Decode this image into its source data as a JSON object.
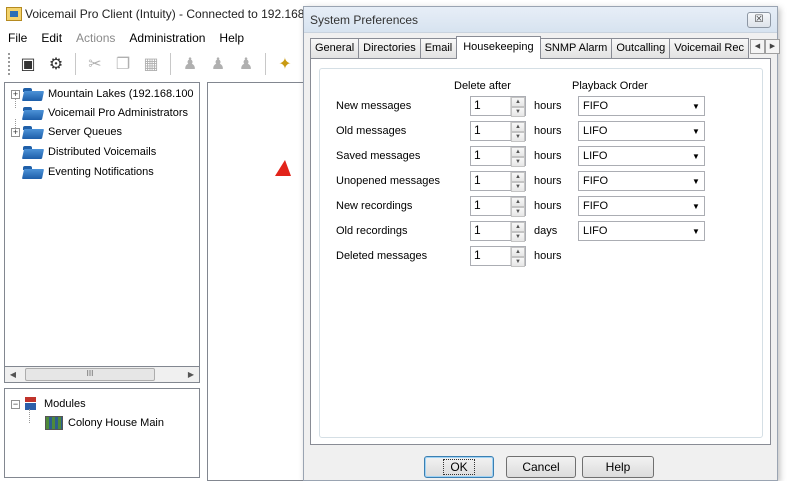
{
  "main_window": {
    "title": "Voicemail Pro Client (Intuity) - Connected to 192.168.",
    "menu": [
      "File",
      "Edit",
      "Actions",
      "Administration",
      "Help"
    ],
    "tree": [
      {
        "label": "Mountain Lakes (192.168.100",
        "expander": "+"
      },
      {
        "label": "Voicemail Pro Administrators",
        "expander": ""
      },
      {
        "label": "Server Queues",
        "expander": "+"
      },
      {
        "label": "Distributed Voicemails",
        "expander": ""
      },
      {
        "label": "Eventing Notifications",
        "expander": ""
      }
    ],
    "scroll_thumb_label": "III",
    "modules": {
      "label": "Modules",
      "expander": "−",
      "child": "Colony House Main"
    }
  },
  "dialog": {
    "title": "System Preferences",
    "close_glyph": "☒",
    "tabs": [
      "General",
      "Directories",
      "Email",
      "Housekeeping",
      "SNMP Alarm",
      "Outcalling",
      "Voicemail Rec"
    ],
    "active_tab": "Housekeeping",
    "columns": {
      "delete_after": "Delete after",
      "playback_order": "Playback Order"
    },
    "rows": [
      {
        "label": "New messages",
        "value": "1",
        "unit": "hours",
        "playback": "FIFO"
      },
      {
        "label": "Old messages",
        "value": "1",
        "unit": "hours",
        "playback": "LIFO"
      },
      {
        "label": "Saved messages",
        "value": "1",
        "unit": "hours",
        "playback": "LIFO"
      },
      {
        "label": "Unopened messages",
        "value": "1",
        "unit": "hours",
        "playback": "FIFO"
      },
      {
        "label": "New recordings",
        "value": "1",
        "unit": "hours",
        "playback": "FIFO"
      },
      {
        "label": "Old recordings",
        "value": "1",
        "unit": "days",
        "playback": "LIFO"
      },
      {
        "label": "Deleted messages",
        "value": "1",
        "unit": "hours",
        "playback": null
      }
    ],
    "buttons": {
      "ok": "OK",
      "cancel": "Cancel",
      "help": "Help"
    }
  },
  "colors": {
    "accent_red": "#e2231a",
    "folder_blue": "#1d5ea9"
  }
}
